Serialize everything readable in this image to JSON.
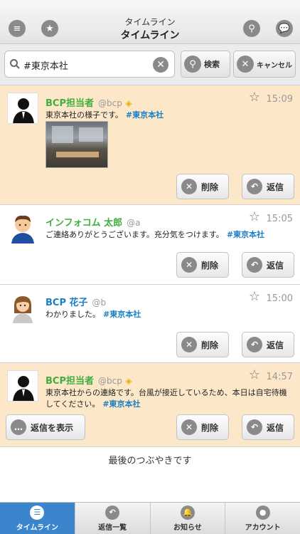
{
  "header": {
    "subtitle": "タイムライン",
    "title": "タイムライン"
  },
  "search": {
    "value": "#東京本社",
    "search_label": "検索",
    "cancel_label": "キャンセル"
  },
  "posts": [
    {
      "name": "BCP担当者",
      "handle": "@bcp",
      "time": "15:09",
      "text": "東京本社の様子です。",
      "tag": "#東京本社",
      "name_color": "#3fae3f"
    },
    {
      "name": "インフォコム 太郎",
      "handle": "@a",
      "time": "15:05",
      "text": "ご連絡ありがとうございます。充分気をつけます。",
      "tag": "#東京本社",
      "name_color": "#3fae3f"
    },
    {
      "name": "BCP 花子",
      "handle": "@b",
      "time": "15:00",
      "text": "わかりました。",
      "tag": "#東京本社",
      "name_color": "#1a7fc4"
    },
    {
      "name": "BCP担当者",
      "handle": "@bcp",
      "time": "14:57",
      "text": "東京本社からの連絡です。台風が接近しているため、本日は自宅待機してください。",
      "tag": "#東京本社",
      "name_color": "#3fae3f"
    }
  ],
  "actions": {
    "delete_label": "削除",
    "reply_label": "返信",
    "show_replies_label": "返信を表示"
  },
  "footer_note": "最後のつぶやきです",
  "tabs": [
    {
      "label": "タイムライン"
    },
    {
      "label": "返信一覧"
    },
    {
      "label": "お知らせ"
    },
    {
      "label": "アカウント"
    }
  ]
}
